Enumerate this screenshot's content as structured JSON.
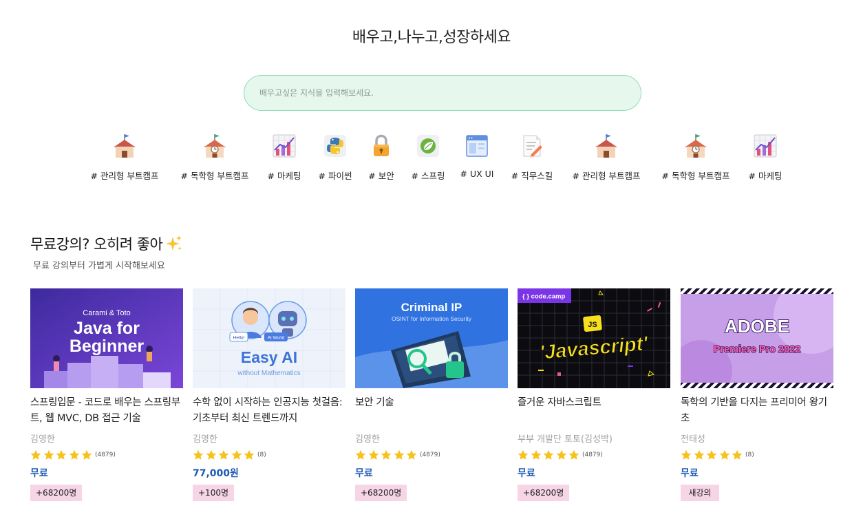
{
  "hero": {
    "title": "배우고,나누고,성장하세요",
    "search_placeholder": "배우고싶은 지식을 입력해보세요."
  },
  "categories": [
    {
      "icon": "schoolhouse-icon",
      "label": "# 관리형 부트캠프"
    },
    {
      "icon": "school-clock-icon",
      "label": "# 독학형 부트캠프"
    },
    {
      "icon": "chart-icon",
      "label": "# 마케팅"
    },
    {
      "icon": "python-icon",
      "label": "# 파이썬"
    },
    {
      "icon": "lock-icon",
      "label": "# 보안"
    },
    {
      "icon": "spring-leaf-icon",
      "label": "# 스프링"
    },
    {
      "icon": "window-icon",
      "label": "# UX UI"
    },
    {
      "icon": "memo-pencil-icon",
      "label": "# 직무스킬"
    },
    {
      "icon": "schoolhouse-icon",
      "label": "# 관리형 부트캠프"
    },
    {
      "icon": "school-clock-icon",
      "label": "# 독학형 부트캠프"
    },
    {
      "icon": "chart-icon",
      "label": "# 마케팅"
    }
  ],
  "section": {
    "title": "무료강의? 오히려 좋아",
    "title_icon": "sparkles-icon",
    "subtitle": "무료 강의부터 가볍게 시작해보세요"
  },
  "courses": [
    {
      "thumb": {
        "line1": "Carami & Toto",
        "line2": "Java for",
        "line3": "Beginner"
      },
      "title": "스프링입문 - 코드로 배우는 스프링부트, 웹 MVC, DB 접근 기술",
      "author": "김영한",
      "rating": 5,
      "reviews": "(4879)",
      "price": "무료",
      "badge": "+68200명"
    },
    {
      "thumb": {
        "line1": "Easy AI",
        "line2": "without Mathematics",
        "bubble1": "Hello!",
        "bubble2": "AI World"
      },
      "title": "수학 없이 시작하는 인공지능 첫걸음: 기초부터 최신 트렌드까지",
      "author": "김영한",
      "rating": 5,
      "reviews": "(8)",
      "price": "77,000원",
      "badge": "+100명"
    },
    {
      "thumb": {
        "line1": "Criminal IP",
        "line2": "OSINT for Information Security"
      },
      "title": "보안 기술",
      "author": "김영한",
      "rating": 5,
      "reviews": "(4879)",
      "price": "무료",
      "badge": "+68200명"
    },
    {
      "thumb": {
        "line1": "{ } code.camp",
        "line2": "'Javascript'",
        "line3": "JS"
      },
      "title": "즐거운 자바스크립트",
      "author": "부부 개발단 토토(김성박)",
      "rating": 5,
      "reviews": "(4879)",
      "price": "무료",
      "badge": "+68200명"
    },
    {
      "thumb": {
        "line1": "ADOBE",
        "line2": "Premiere Pro 2022"
      },
      "title": "독학의 기반을 다지는 프리미어 왕기초",
      "author": "전태성",
      "rating": 5,
      "reviews": "(8)",
      "price": "무료",
      "badge": "새강의"
    }
  ]
}
